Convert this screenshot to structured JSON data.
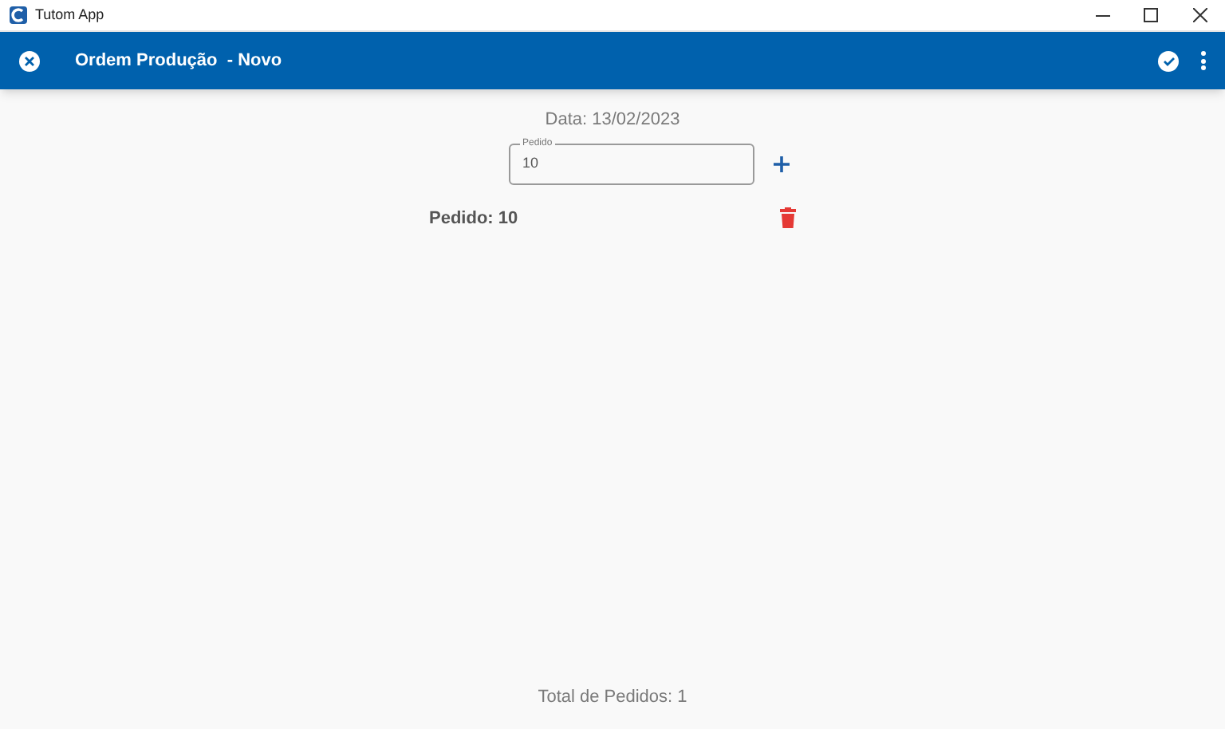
{
  "window": {
    "title": "Tutom App"
  },
  "header": {
    "title": "Ordem Produção  - Novo"
  },
  "date": "Data: 13/02/2023",
  "field": {
    "label": "Pedido",
    "value": "10"
  },
  "orders": [
    {
      "label": "Pedido: 10"
    }
  ],
  "footer": "Total de Pedidos: 1"
}
